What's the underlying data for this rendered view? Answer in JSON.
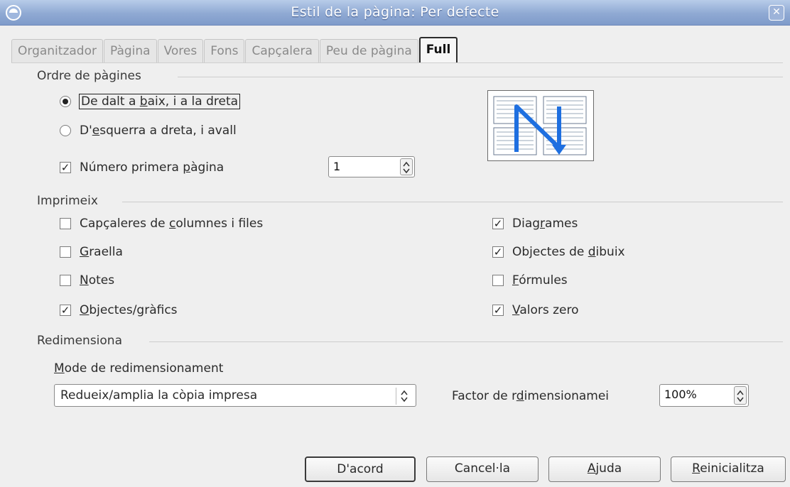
{
  "window": {
    "title": "Estil de la pàgina: Per defecte"
  },
  "tabs": [
    {
      "label": "Organitzador"
    },
    {
      "label": "Pàgina"
    },
    {
      "label": "Vores"
    },
    {
      "label": "Fons"
    },
    {
      "label": "Capçalera"
    },
    {
      "label": "Peu de pàgina"
    },
    {
      "label": "Full"
    }
  ],
  "page_order": {
    "heading": "Ordre de pàgines",
    "option_top_bottom": {
      "pre": "De dalt a ",
      "mn": "b",
      "post": "aix, i a la dreta",
      "selected": true
    },
    "option_left_right": {
      "pre": "D'",
      "mn": "e",
      "post": "squerra a dreta, i avall",
      "selected": false
    },
    "first_page": {
      "pre": "Número primera ",
      "mn": "p",
      "post": "àgina",
      "checked": true,
      "value": "1"
    }
  },
  "print": {
    "heading": "Imprimeix",
    "headers": {
      "pre": "Capçaleres de ",
      "mn": "c",
      "post": "olumnes i files",
      "checked": false
    },
    "grid": {
      "pre": "",
      "mn": "G",
      "post": "raella",
      "checked": false
    },
    "notes": {
      "pre": "",
      "mn": "N",
      "post": "otes",
      "checked": false
    },
    "objects": {
      "pre": "",
      "mn": "O",
      "post": "bjectes/gràfics",
      "checked": true
    },
    "charts": {
      "pre": "Diag",
      "mn": "r",
      "post": "ames",
      "checked": true
    },
    "drawing": {
      "pre": "Objectes de ",
      "mn": "d",
      "post": "ibuix",
      "checked": true
    },
    "formulas": {
      "pre": "",
      "mn": "F",
      "post": "órmules",
      "checked": false
    },
    "zero": {
      "pre": "",
      "mn": "V",
      "post": "alors zero",
      "checked": true
    }
  },
  "scale": {
    "heading": "Redimensiona",
    "mode_label": {
      "pre": "",
      "mn": "M",
      "post": "ode de redimensionament"
    },
    "mode_value": "Redueix/amplia la còpia impresa",
    "factor_label": {
      "pre": "Factor de r",
      "mn": "d",
      "post": "imensionamei"
    },
    "factor_value": "100%"
  },
  "buttons": {
    "ok": {
      "pre": "D'acord",
      "mn": "",
      "post": ""
    },
    "cancel": {
      "pre": "Cancel·la",
      "mn": "",
      "post": ""
    },
    "help": {
      "pre": "",
      "mn": "A",
      "post": "juda"
    },
    "reset": {
      "pre": "",
      "mn": "R",
      "post": "einicialitza"
    }
  },
  "marks": {
    "checked": "☑",
    "check_glyph": "✓"
  },
  "colors": {
    "accent_arrow": "#1e6fe0",
    "titlebar": "#8fa9d3"
  }
}
